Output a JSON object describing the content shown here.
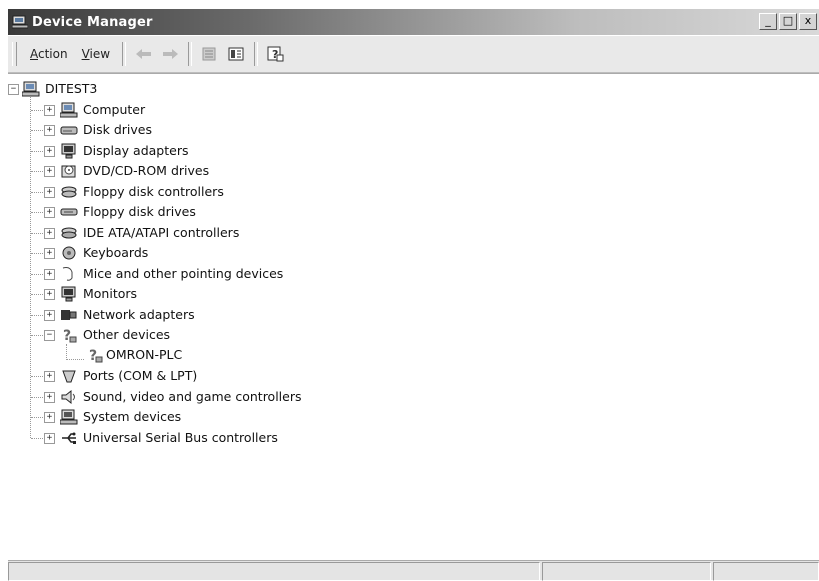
{
  "window": {
    "title": "Device Manager",
    "controls": [
      "_",
      "□",
      "x"
    ]
  },
  "menu": [
    {
      "label": "Action",
      "accel": "A",
      "rest": "ction"
    },
    {
      "label": "View",
      "accel": "V",
      "rest": "iew"
    }
  ],
  "toolbar": {
    "buttons": [
      "back-icon",
      "forward-icon",
      "properties-icon",
      "details-view-icon",
      "help-icon"
    ]
  },
  "tree": {
    "root": {
      "label": "DITEST3",
      "expanded": true,
      "icon": "computer-icon"
    },
    "items": [
      {
        "label": "Computer",
        "icon": "computer-icon",
        "expanded": false
      },
      {
        "label": "Disk drives",
        "icon": "disk-drive-icon",
        "expanded": false
      },
      {
        "label": "Display adapters",
        "icon": "display-adapter-icon",
        "expanded": false
      },
      {
        "label": "DVD/CD-ROM drives",
        "icon": "cdrom-icon",
        "expanded": false
      },
      {
        "label": "Floppy disk controllers",
        "icon": "floppy-controller-icon",
        "expanded": false
      },
      {
        "label": "Floppy disk drives",
        "icon": "floppy-drive-icon",
        "expanded": false
      },
      {
        "label": "IDE ATA/ATAPI controllers",
        "icon": "ide-controller-icon",
        "expanded": false
      },
      {
        "label": "Keyboards",
        "icon": "keyboard-icon",
        "expanded": false
      },
      {
        "label": "Mice and other pointing devices",
        "icon": "mouse-icon",
        "expanded": false
      },
      {
        "label": "Monitors",
        "icon": "monitor-icon",
        "expanded": false
      },
      {
        "label": "Network adapters",
        "icon": "network-adapter-icon",
        "expanded": false
      },
      {
        "label": "Other devices",
        "icon": "unknown-device-icon",
        "expanded": true,
        "children": [
          {
            "label": "OMRON-PLC",
            "icon": "unknown-device-icon"
          }
        ]
      },
      {
        "label": "Ports (COM & LPT)",
        "icon": "port-icon",
        "expanded": false
      },
      {
        "label": "Sound, video and game controllers",
        "icon": "sound-icon",
        "expanded": false
      },
      {
        "label": "System devices",
        "icon": "system-device-icon",
        "expanded": false
      },
      {
        "label": "Universal Serial Bus controllers",
        "icon": "usb-icon",
        "expanded": false
      }
    ]
  },
  "status_bar": {
    "panes": [
      "",
      "",
      ""
    ]
  }
}
